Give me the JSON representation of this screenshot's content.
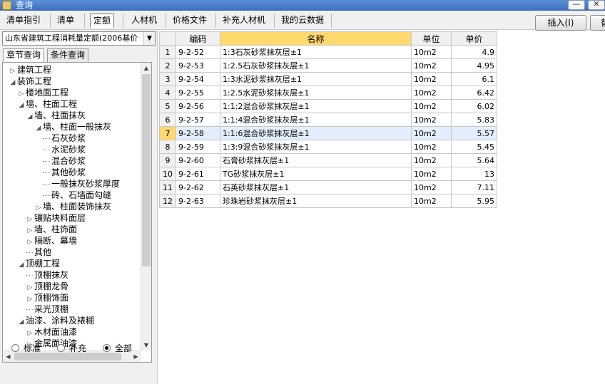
{
  "window": {
    "title": "查询",
    "minimize_glyph": "—",
    "close_glyph": "✕"
  },
  "tabs": [
    {
      "label": "清单指引"
    },
    {
      "label": "清单"
    },
    {
      "label": "定额"
    },
    {
      "label": "人材机"
    },
    {
      "label": "价格文件"
    },
    {
      "label": "补充人材机"
    },
    {
      "label": "我的云数据"
    }
  ],
  "toolbar": {
    "insert_label": "插入(I)",
    "replace_label": "替"
  },
  "left": {
    "combo_value": "山东省建筑工程消耗量定额(2006基价",
    "subtabs": [
      {
        "label": "章节查询"
      },
      {
        "label": "条件查询"
      }
    ],
    "tree": [
      {
        "label": "建筑工程",
        "level": 0,
        "exp": "▷"
      },
      {
        "label": "装饰工程",
        "level": 0,
        "exp": "◢"
      },
      {
        "label": "楼地面工程",
        "level": 1,
        "exp": "▷"
      },
      {
        "label": "墙、柱面工程",
        "level": 1,
        "exp": "◢"
      },
      {
        "label": "墙、柱面抹灰",
        "level": 2,
        "exp": "◢"
      },
      {
        "label": "墙、柱面一般抹灰",
        "level": 3,
        "exp": "◢"
      },
      {
        "label": "石灰砂浆",
        "level": 4,
        "exp": ""
      },
      {
        "label": "水泥砂浆",
        "level": 4,
        "exp": ""
      },
      {
        "label": "混合砂浆",
        "level": 4,
        "exp": ""
      },
      {
        "label": "其他砂浆",
        "level": 4,
        "exp": ""
      },
      {
        "label": "一般抹灰砂浆厚度",
        "level": 4,
        "exp": ""
      },
      {
        "label": "砖、石墙面勾缝",
        "level": 4,
        "exp": ""
      },
      {
        "label": "墙、柱面装饰抹灰",
        "level": 3,
        "exp": "▷"
      },
      {
        "label": "镶贴块料面层",
        "level": 2,
        "exp": "▷"
      },
      {
        "label": "墙、柱饰面",
        "level": 2,
        "exp": "▷"
      },
      {
        "label": "隔断、幕墙",
        "level": 2,
        "exp": "▷"
      },
      {
        "label": "其他",
        "level": 2,
        "exp": ""
      },
      {
        "label": "顶棚工程",
        "level": 1,
        "exp": "◢"
      },
      {
        "label": "顶棚抹灰",
        "level": 2,
        "exp": ""
      },
      {
        "label": "顶棚龙骨",
        "level": 2,
        "exp": "▷"
      },
      {
        "label": "顶棚饰面",
        "level": 2,
        "exp": "▷"
      },
      {
        "label": "采光顶棚",
        "level": 2,
        "exp": ""
      },
      {
        "label": "油漆、涂料及裱糊",
        "level": 1,
        "exp": "◢"
      },
      {
        "label": "木材面油漆",
        "level": 2,
        "exp": "▷"
      },
      {
        "label": "金属面油漆",
        "level": 2,
        "exp": "▷"
      }
    ],
    "radios": [
      {
        "label": "标准",
        "checked": false
      },
      {
        "label": "补充",
        "checked": false
      },
      {
        "label": "全部",
        "checked": true
      }
    ]
  },
  "grid": {
    "headers": [
      "",
      "编码",
      "名称",
      "单位",
      "单价"
    ],
    "rows": [
      {
        "num": "1",
        "code": "9-2-52",
        "name": "1:3石灰砂浆抹灰层±1",
        "unit": "10m2",
        "price": "4.9"
      },
      {
        "num": "2",
        "code": "9-2-53",
        "name": "1:2.5石灰砂浆抹灰层±1",
        "unit": "10m2",
        "price": "4.95"
      },
      {
        "num": "3",
        "code": "9-2-54",
        "name": "1:3水泥砂浆抹灰层±1",
        "unit": "10m2",
        "price": "6.1"
      },
      {
        "num": "4",
        "code": "9-2-55",
        "name": "1:2.5水泥砂浆抹灰层±1",
        "unit": "10m2",
        "price": "6.42"
      },
      {
        "num": "5",
        "code": "9-2-56",
        "name": "1:1:2混合砂浆抹灰层±1",
        "unit": "10m2",
        "price": "6.02"
      },
      {
        "num": "6",
        "code": "9-2-57",
        "name": "1:1:4混合砂浆抹灰层±1",
        "unit": "10m2",
        "price": "5.83"
      },
      {
        "num": "7",
        "code": "9-2-58",
        "name": "1:1:6混合砂浆抹灰层±1",
        "unit": "10m2",
        "price": "5.57",
        "selected": true
      },
      {
        "num": "8",
        "code": "9-2-59",
        "name": "1:3:9混合砂浆抹灰层±1",
        "unit": "10m2",
        "price": "5.45"
      },
      {
        "num": "9",
        "code": "9-2-60",
        "name": "石膏砂浆抹灰层±1",
        "unit": "10m2",
        "price": "5.64"
      },
      {
        "num": "10",
        "code": "9-2-61",
        "name": "TG砂浆抹灰层±1",
        "unit": "10m2",
        "price": "13"
      },
      {
        "num": "11",
        "code": "9-2-62",
        "name": "石英砂浆抹灰层±1",
        "unit": "10m2",
        "price": "7.11"
      },
      {
        "num": "12",
        "code": "9-2-63",
        "name": "珍珠岩砂浆抹灰层±1",
        "unit": "10m2",
        "price": "5.95"
      }
    ]
  }
}
